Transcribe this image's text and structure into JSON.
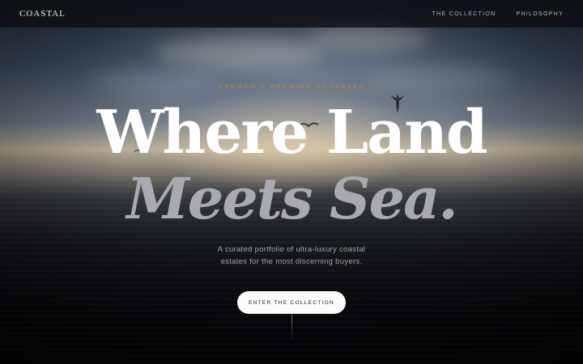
{
  "nav": {
    "brand": "COASTAL",
    "links": [
      {
        "label": "THE COLLECTION"
      },
      {
        "label": "PHILOSOPHY"
      }
    ]
  },
  "hero": {
    "eyebrow": "OREGON'S PREMIER ENCLAVES",
    "title_line1": "Where Land",
    "title_line2": "Meets Sea.",
    "subtitle_line1": "A curated portfolio of ultra-luxury coastal",
    "subtitle_line2": "estates for the most discerning buyers.",
    "cta_label": "ENTER THE COLLECTION"
  },
  "colors": {
    "accent_gold": "#b9863e",
    "title_white": "#ffffff",
    "title_muted": "#a9aab0",
    "cta_bg": "#fbfbfb"
  },
  "icons": [
    "seagull-icon",
    "seagull-icon",
    "seagull-icon"
  ]
}
